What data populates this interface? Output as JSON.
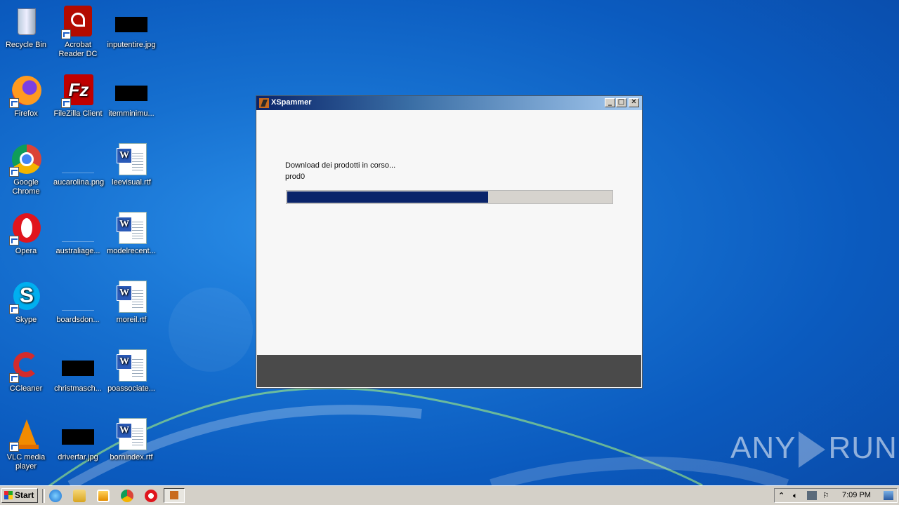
{
  "desktop": {
    "icons": [
      {
        "label": "Recycle Bin"
      },
      {
        "label": "Acrobat Reader DC"
      },
      {
        "label": "inputentire.jpg"
      },
      {
        "label": "Firefox"
      },
      {
        "label": "FileZilla Client"
      },
      {
        "label": "itemminimu..."
      },
      {
        "label": "Google Chrome"
      },
      {
        "label": "aucarolina.png"
      },
      {
        "label": "leevisual.rtf"
      },
      {
        "label": "Opera"
      },
      {
        "label": "australiage..."
      },
      {
        "label": "modelrecent..."
      },
      {
        "label": "Skype"
      },
      {
        "label": "boardsdon..."
      },
      {
        "label": "moreil.rtf"
      },
      {
        "label": "CCleaner"
      },
      {
        "label": "christmasch..."
      },
      {
        "label": "poassociate..."
      },
      {
        "label": "VLC media player"
      },
      {
        "label": "driverfar.jpg"
      },
      {
        "label": "bornindex.rtf"
      }
    ]
  },
  "window": {
    "title": "XSpammer",
    "status_text": "Download dei prodotti in corso...",
    "item_text": "prod0",
    "progress_fraction": 0.62,
    "progress_color": "#0a246a"
  },
  "watermark": {
    "text_left": "ANY",
    "text_right": "RUN"
  },
  "taskbar": {
    "start_label": "Start",
    "clock": "7:09 PM"
  }
}
